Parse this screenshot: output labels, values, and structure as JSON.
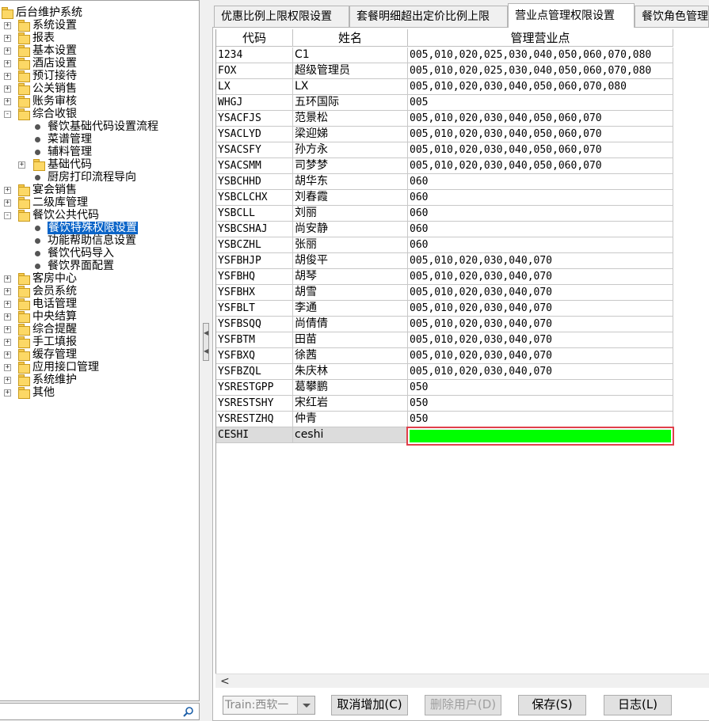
{
  "tree": {
    "root": "后台维护系统",
    "items": [
      {
        "label": "系统设置",
        "icon": "folder-icon",
        "expander": "+"
      },
      {
        "label": "报表",
        "icon": "folder-icon",
        "expander": "+"
      },
      {
        "label": "基本设置",
        "icon": "folder-icon",
        "expander": "+"
      },
      {
        "label": "酒店设置",
        "icon": "folder-icon",
        "expander": "+"
      },
      {
        "label": "预订接待",
        "icon": "folder-icon",
        "expander": "+"
      },
      {
        "label": "公关销售",
        "icon": "folder-icon",
        "expander": "+"
      },
      {
        "label": "账务审核",
        "icon": "folder-icon",
        "expander": "+"
      },
      {
        "label": "综合收银",
        "icon": "folder-icon",
        "expander": "-"
      },
      {
        "label": "餐饮基础代码设置流程",
        "icon": "bullet-icon",
        "expander": ""
      },
      {
        "label": "菜谱管理",
        "icon": "bullet-icon",
        "expander": ""
      },
      {
        "label": "辅料管理",
        "icon": "bullet-icon",
        "expander": ""
      },
      {
        "label": "基础代码",
        "icon": "folder-icon",
        "expander": "+"
      },
      {
        "label": "厨房打印流程导向",
        "icon": "bullet-icon",
        "expander": ""
      },
      {
        "label": "宴会销售",
        "icon": "folder-icon",
        "expander": "+"
      },
      {
        "label": "二级库管理",
        "icon": "folder-icon",
        "expander": "+"
      },
      {
        "label": "餐饮公共代码",
        "icon": "folder-icon",
        "expander": "-"
      },
      {
        "label": "餐饮特殊权限设置",
        "icon": "bullet-icon",
        "expander": ""
      },
      {
        "label": "功能帮助信息设置",
        "icon": "bullet-icon",
        "expander": ""
      },
      {
        "label": "餐饮代码导入",
        "icon": "bullet-icon",
        "expander": ""
      },
      {
        "label": "餐饮界面配置",
        "icon": "bullet-icon",
        "expander": ""
      },
      {
        "label": "客房中心",
        "icon": "folder-icon",
        "expander": "+"
      },
      {
        "label": "会员系统",
        "icon": "folder-icon",
        "expander": "+"
      },
      {
        "label": "电话管理",
        "icon": "folder-icon",
        "expander": "+"
      },
      {
        "label": "中央结算",
        "icon": "folder-icon",
        "expander": "+"
      },
      {
        "label": "综合提醒",
        "icon": "folder-icon",
        "expander": "+"
      },
      {
        "label": "手工填报",
        "icon": "folder-icon",
        "expander": "+"
      },
      {
        "label": "缓存管理",
        "icon": "folder-icon",
        "expander": "+"
      },
      {
        "label": "应用接口管理",
        "icon": "folder-icon",
        "expander": "+"
      },
      {
        "label": "系统维护",
        "icon": "folder-icon",
        "expander": "+"
      },
      {
        "label": "其他",
        "icon": "folder-icon",
        "expander": "+"
      }
    ],
    "selected": "餐饮特殊权限设置"
  },
  "splitter": {
    "arrow_up": "◀",
    "arrow_down": "◀"
  },
  "tabs": [
    {
      "label": "优惠比例上限权限设置"
    },
    {
      "label": "套餐明细超出定价比例上限"
    },
    {
      "label": "营业点管理权限设置"
    },
    {
      "label": "餐饮角色管理"
    }
  ],
  "active_tab": "营业点管理权限设置",
  "grid": {
    "columns": [
      "代码",
      "姓名",
      "管理营业点"
    ],
    "rows": [
      [
        "1234",
        "C1",
        "005,010,020,025,030,040,050,060,070,080"
      ],
      [
        "FOX",
        "超级管理员",
        "005,010,020,025,030,040,050,060,070,080"
      ],
      [
        "LX",
        "LX",
        "005,010,020,030,040,050,060,070,080"
      ],
      [
        "WHGJ",
        "五环国际",
        "005"
      ],
      [
        "YSACFJS",
        "范景松",
        "005,010,020,030,040,050,060,070"
      ],
      [
        "YSACLYD",
        "梁迎娣",
        "005,010,020,030,040,050,060,070"
      ],
      [
        "YSACSFY",
        "孙方永",
        "005,010,020,030,040,050,060,070"
      ],
      [
        "YSACSMM",
        "司梦梦",
        "005,010,020,030,040,050,060,070"
      ],
      [
        "YSBCHHD",
        "胡华东",
        "060"
      ],
      [
        "YSBCLCHX",
        "刘春霞",
        "060"
      ],
      [
        "YSBCLL",
        "刘丽",
        "060"
      ],
      [
        "YSBCSHAJ",
        "尚安静",
        "060"
      ],
      [
        "YSBCZHL",
        "张丽",
        "060"
      ],
      [
        "YSFBHJP",
        "胡俊平",
        "005,010,020,030,040,070"
      ],
      [
        "YSFBHQ",
        "胡琴",
        "005,010,020,030,040,070"
      ],
      [
        "YSFBHX",
        "胡雪",
        "005,010,020,030,040,070"
      ],
      [
        "YSFBLT",
        "李通",
        "005,010,020,030,040,070"
      ],
      [
        "YSFBSQQ",
        "尚倩倩",
        "005,010,020,030,040,070"
      ],
      [
        "YSFBTM",
        "田苗",
        "005,010,020,030,040,070"
      ],
      [
        "YSFBXQ",
        "徐茜",
        "005,010,020,030,040,070"
      ],
      [
        "YSFBZQL",
        "朱庆林",
        "005,010,020,030,040,070"
      ],
      [
        "YSRESTGPP",
        "葛攀鹏",
        "050"
      ],
      [
        "YSRESTSHY",
        "宋红岩",
        "050"
      ],
      [
        "YSRESTZHQ",
        "仲青",
        "050"
      ],
      [
        "CESHI",
        "ceshi",
        ""
      ]
    ],
    "editing_cell_color": "#00ff00",
    "editing_border_color": "#e0404a"
  },
  "hscroll": {
    "left_arrow": "<"
  },
  "toolbar": {
    "combo_value": "Train:西软一",
    "cancel_add_label": "取消增加(C)",
    "delete_user_label": "删除用户(D)",
    "save_label": "保存(S)",
    "log_label": "日志(L)"
  },
  "colors": {
    "selection": "#0a64c8",
    "edit_fill": "#00ff00",
    "edit_border": "#e0404a"
  }
}
